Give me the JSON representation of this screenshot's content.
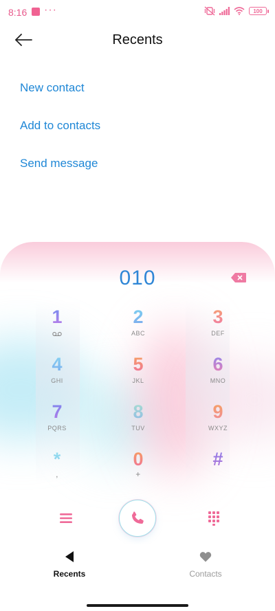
{
  "status_bar": {
    "time": "8:16",
    "dots": "···",
    "battery": "100"
  },
  "header": {
    "title": "Recents",
    "back_icon": "arrow-left-icon"
  },
  "actions": [
    {
      "label": "New contact"
    },
    {
      "label": "Add to contacts"
    },
    {
      "label": "Send message"
    }
  ],
  "dialpad": {
    "number": "010",
    "keys": [
      {
        "digit": "1",
        "letters": ""
      },
      {
        "digit": "2",
        "letters": "ABC"
      },
      {
        "digit": "3",
        "letters": "DEF"
      },
      {
        "digit": "4",
        "letters": "GHI"
      },
      {
        "digit": "5",
        "letters": "JKL"
      },
      {
        "digit": "6",
        "letters": "MNO"
      },
      {
        "digit": "7",
        "letters": "PQRS"
      },
      {
        "digit": "8",
        "letters": "TUV"
      },
      {
        "digit": "9",
        "letters": "WXYZ"
      },
      {
        "digit": "*",
        "letters": ","
      },
      {
        "digit": "0",
        "letters": "+"
      },
      {
        "digit": "#",
        "letters": ""
      }
    ]
  },
  "bottom_nav": {
    "tabs": [
      {
        "label": "Recents",
        "icon": "triangle-icon",
        "active": true
      },
      {
        "label": "Contacts",
        "icon": "heart-icon",
        "active": false
      }
    ]
  },
  "colors": {
    "accent_blue": "#1f87d6",
    "number_blue": "#2f86d6",
    "accent_pink": "#ef6a98",
    "call_ring": "#9ee0ea"
  }
}
